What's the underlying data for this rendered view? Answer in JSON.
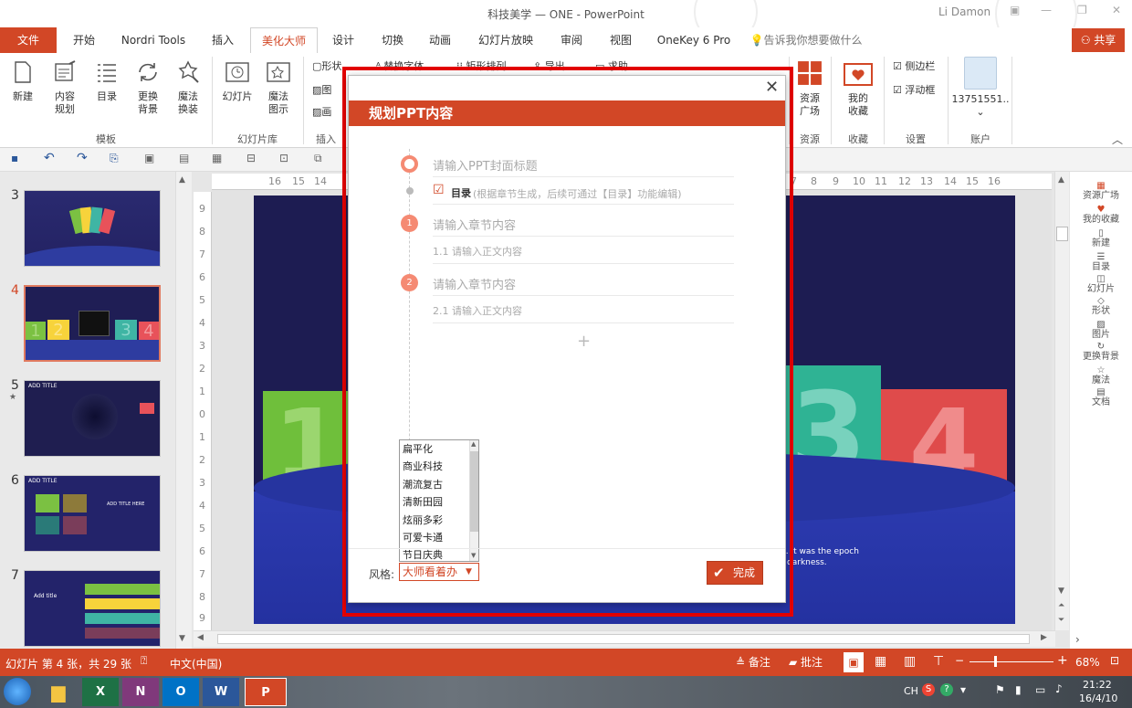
{
  "window": {
    "title": "科技美学 — ONE - PowerPoint",
    "user": "Li Damon"
  },
  "menu": {
    "file": "文件",
    "tabs": [
      "开始",
      "Nordri Tools",
      "插入",
      "美化大师",
      "设计",
      "切换",
      "动画",
      "幻灯片放映",
      "审阅",
      "视图",
      "OneKey 6 Pro"
    ],
    "tell": "告诉我你想要做什么",
    "share": "共享"
  },
  "ribbon": {
    "template_buttons": [
      "新建",
      "内容规划",
      "目录",
      "更换背景",
      "魔法换装"
    ],
    "template_group": "模板",
    "lib_buttons": [
      "幻灯片",
      "魔法图示"
    ],
    "lib_group": "幻灯片库",
    "insert_items": [
      "形状",
      "图",
      "画"
    ],
    "insert_group": "插入",
    "misc_labels": [
      "替换字体",
      "矩形排列",
      "导出",
      "求助"
    ],
    "resource_button": "资源广场",
    "resource_group": "资源",
    "fav_button": "我的收藏",
    "fav_group": "收藏",
    "settings_checks": [
      "侧边栏",
      "浮动框"
    ],
    "settings_group": "设置",
    "account_name": "13751551..",
    "account_group": "账户"
  },
  "thumbs": {
    "numbers": [
      "3",
      "4",
      "5",
      "6",
      "7"
    ],
    "texts": [
      "1",
      "2",
      "3",
      "4",
      "ADD TITLE",
      "ADD TITLE",
      "ADD TITLE HERE",
      "Add title"
    ]
  },
  "ruler": {
    "h_left": [
      "16",
      "15",
      "14"
    ],
    "h_right": [
      "7",
      "8",
      "9",
      "10",
      "11",
      "12",
      "13",
      "14",
      "15",
      "16"
    ],
    "v": [
      "9",
      "8",
      "7",
      "6",
      "5",
      "4",
      "3",
      "2",
      "1",
      "0",
      "1",
      "2",
      "3",
      "4",
      "5",
      "6",
      "7",
      "8",
      "9"
    ]
  },
  "slide": {
    "nums": [
      "1",
      "3",
      "4"
    ],
    "caption1": "s. It was the epoch",
    "caption2": "f darkness."
  },
  "rightpanel": [
    "资源广场",
    "我的收藏",
    "新建",
    "目录",
    "幻灯片",
    "形状",
    "图片",
    "更换背景",
    "魔法",
    "文档"
  ],
  "dialog": {
    "title": "规划PPT内容",
    "cover_placeholder": "请输入PPT封面标题",
    "toc_label": "目录",
    "toc_note": "(根据章节生成，后续可通过【目录】功能编辑)",
    "chapters": [
      {
        "num": "1",
        "title": "请输入章节内容",
        "sub": "1.1 请输入正文内容"
      },
      {
        "num": "2",
        "title": "请输入章节内容",
        "sub": "2.1 请输入正文内容"
      }
    ],
    "add": "+",
    "style_label": "风格:",
    "style_value": "大师看着办",
    "style_options": [
      "扁平化",
      "商业科技",
      "潮流复古",
      "清新田园",
      "炫丽多彩",
      "可爱卡通",
      "节日庆典"
    ],
    "done": "完成"
  },
  "status": {
    "slide_info": "幻灯片 第 4 张，共 29 张",
    "lang": "中文(中国)",
    "notes": "备注",
    "comments": "批注",
    "zoom": "68%"
  },
  "taskbar": {
    "apps": [
      "X",
      "N",
      "O",
      "W",
      "P"
    ],
    "time": "21:22",
    "date": "16/4/10",
    "ime": "CH"
  }
}
